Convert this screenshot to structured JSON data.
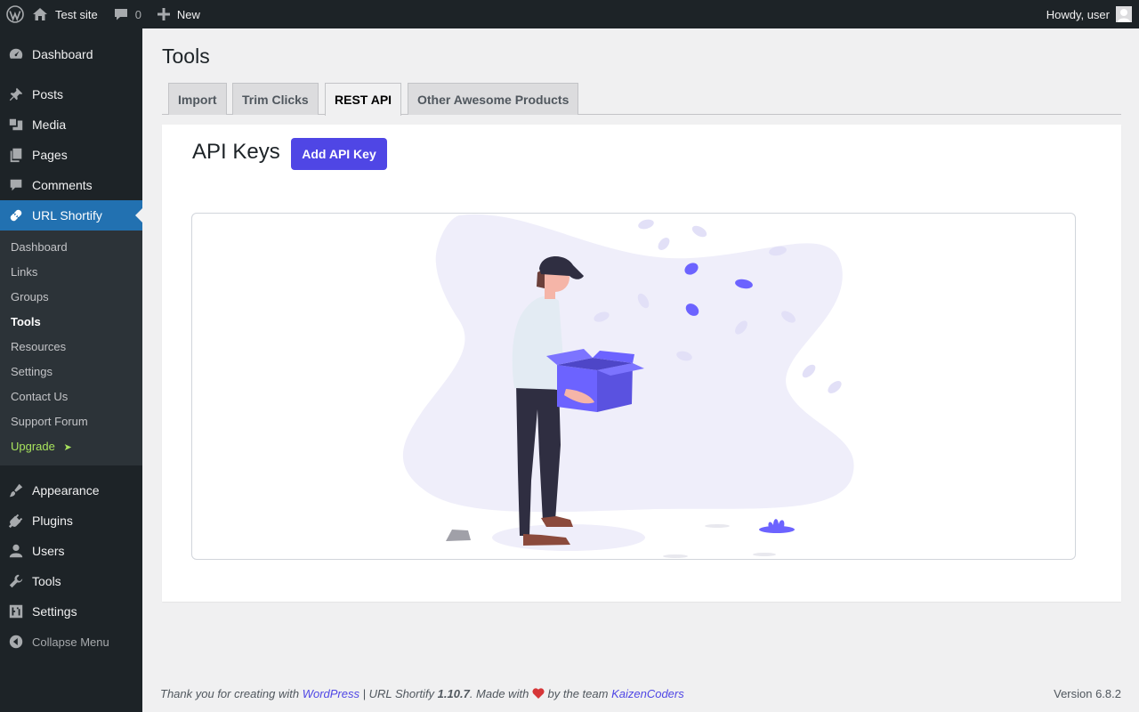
{
  "adminbar": {
    "site_name": "Test site",
    "comments_count": "0",
    "new_label": "New",
    "howdy": "Howdy, user"
  },
  "sidebar": {
    "items": [
      {
        "label": "Dashboard",
        "icon": "dashboard-icon"
      },
      {
        "label": "Posts",
        "icon": "pin-icon"
      },
      {
        "label": "Media",
        "icon": "media-icon"
      },
      {
        "label": "Pages",
        "icon": "pages-icon"
      },
      {
        "label": "Comments",
        "icon": "comment-icon"
      },
      {
        "label": "URL Shortify",
        "icon": "link-icon"
      },
      {
        "label": "Appearance",
        "icon": "paintbrush-icon"
      },
      {
        "label": "Plugins",
        "icon": "plugin-icon"
      },
      {
        "label": "Users",
        "icon": "user-icon"
      },
      {
        "label": "Tools",
        "icon": "wrench-icon"
      },
      {
        "label": "Settings",
        "icon": "settings-icon"
      }
    ],
    "submenu": [
      "Dashboard",
      "Links",
      "Groups",
      "Tools",
      "Resources",
      "Settings",
      "Contact Us",
      "Support Forum"
    ],
    "upgrade_label": "Upgrade",
    "upgrade_arrow": "➤",
    "collapse_label": "Collapse Menu"
  },
  "main": {
    "title": "Tools",
    "tabs": [
      "Import",
      "Trim Clicks",
      "REST API",
      "Other Awesome Products"
    ],
    "active_tab": "REST API",
    "section_title": "API Keys",
    "add_button": "Add API Key"
  },
  "footer": {
    "text_1": "Thank you for creating with ",
    "wp_link": "WordPress",
    "text_2": " | URL Shortify ",
    "version_bold": "1.10.7",
    "text_3": ". Made with ",
    "text_4": " by the team ",
    "team_link": "KaizenCoders",
    "wp_version": "Version 6.8.2"
  },
  "colors": {
    "accent": "#4f46e5",
    "admin_dark": "#1d2327",
    "wp_blue": "#2271b1",
    "heart": "#d63638",
    "upgrade": "#a8e35d"
  }
}
